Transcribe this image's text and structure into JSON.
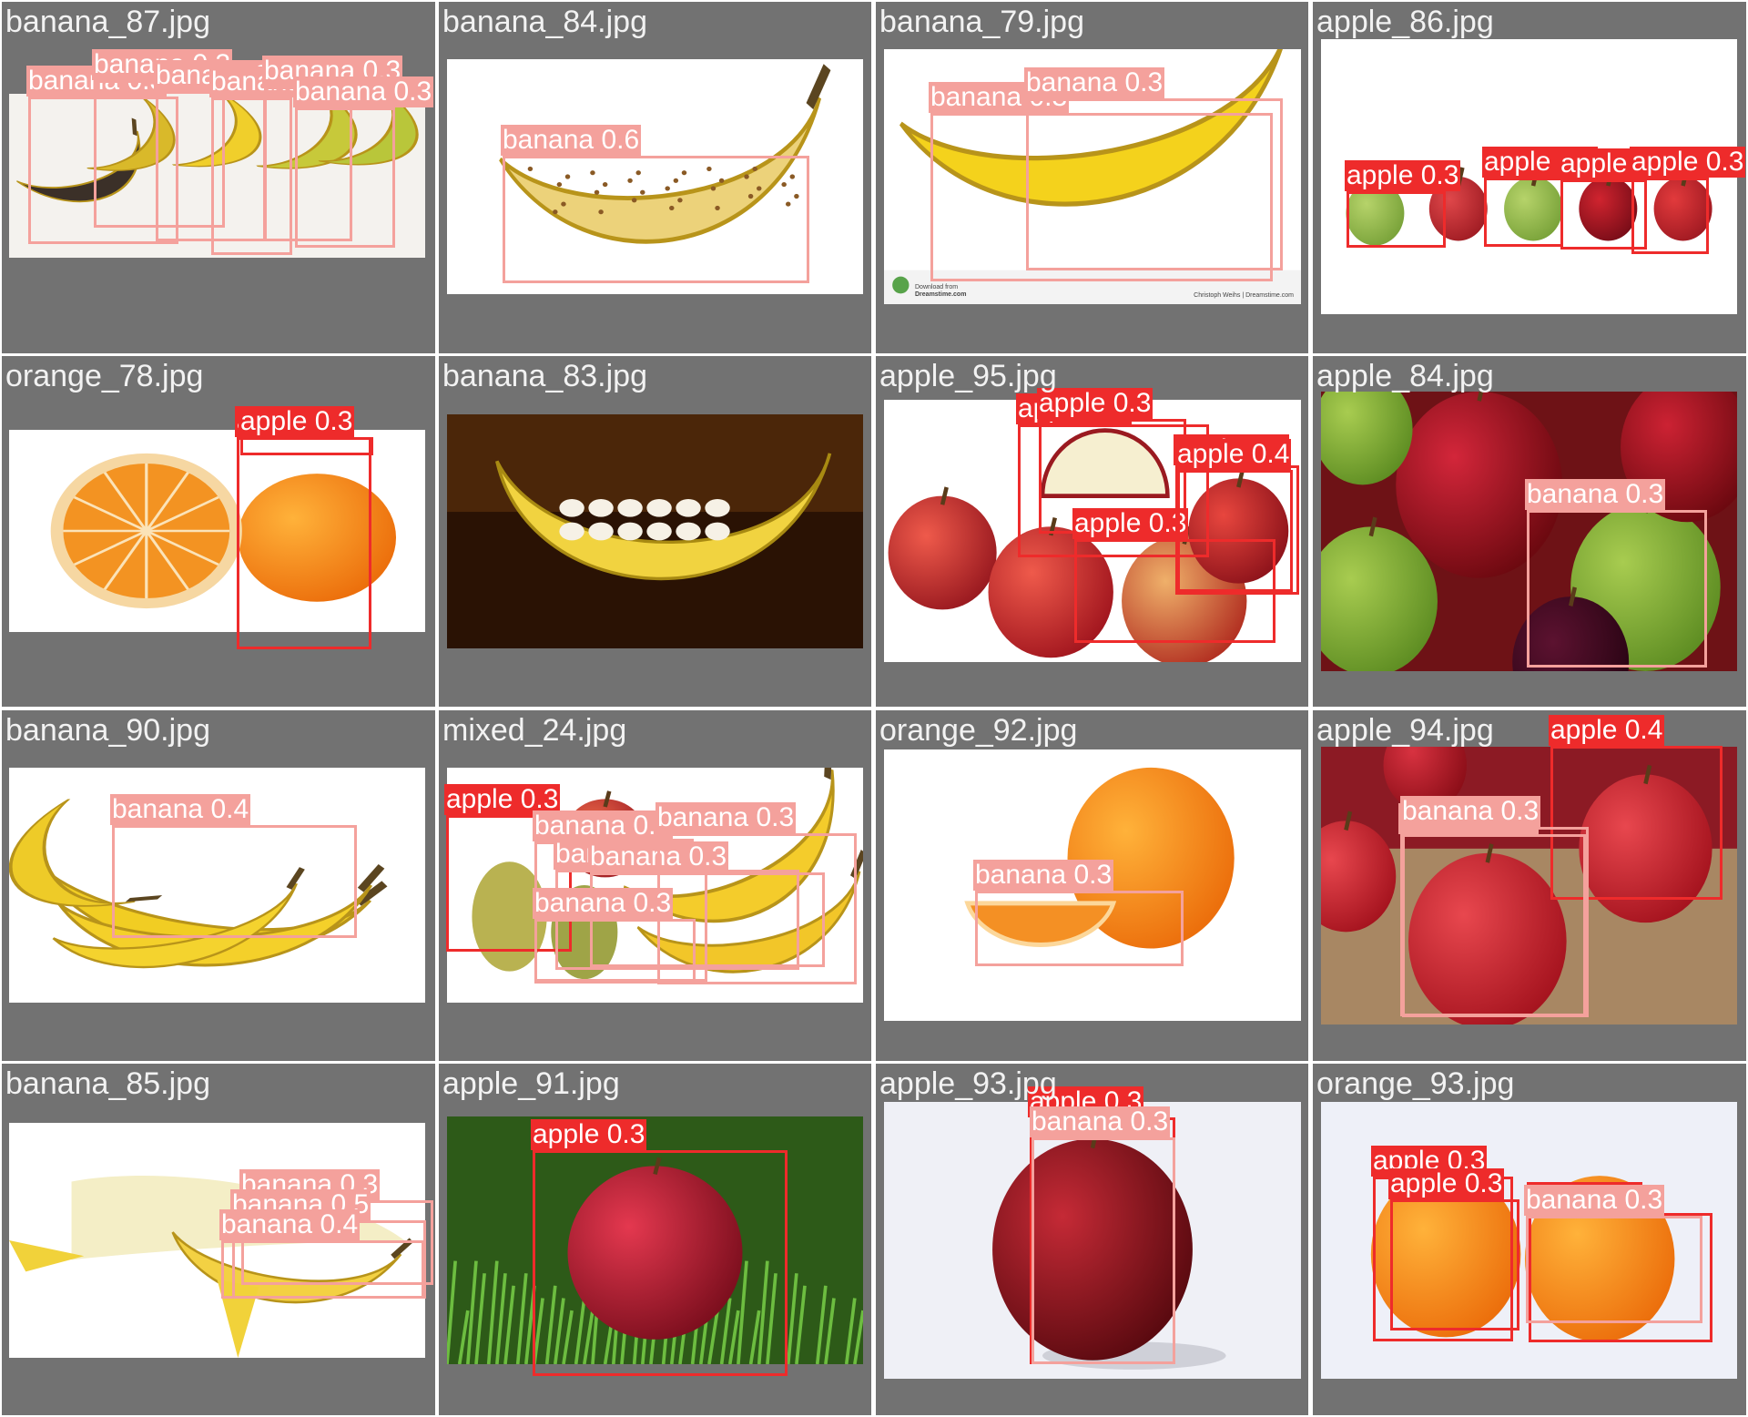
{
  "class_colors": {
    "apple": "#ee2b2b",
    "banana": "#f4a19c",
    "orange": "#ee2b2b"
  },
  "tiles": [
    {
      "filename": "banana_87.jpg",
      "scene": "bananas_row",
      "detections": [
        {
          "label": "banana 0.3",
          "cls": "banana"
        },
        {
          "label": "banana 0.3",
          "cls": "banana"
        },
        {
          "label": "banana 0.3",
          "cls": "banana"
        },
        {
          "label": "banana 0.3",
          "cls": "banana"
        },
        {
          "label": "banana 0.3",
          "cls": "banana"
        },
        {
          "label": "banana 0.3",
          "cls": "banana"
        }
      ]
    },
    {
      "filename": "banana_84.jpg",
      "scene": "single_banana_spotted",
      "detections": [
        {
          "label": "banana 0.6",
          "cls": "banana"
        }
      ]
    },
    {
      "filename": "banana_79.jpg",
      "scene": "single_banana_stock",
      "watermark": {
        "line1": "Download from",
        "line2": "Dreamstime.com",
        "right": "Christoph Weihs | Dreamstime.com"
      },
      "detections": [
        {
          "label": "banana 0.3",
          "cls": "banana"
        },
        {
          "label": "banana 0.3",
          "cls": "banana"
        }
      ]
    },
    {
      "filename": "apple_86.jpg",
      "scene": "five_apples_row",
      "detections": [
        {
          "label": "apple 0.3",
          "cls": "apple"
        },
        {
          "label": "apple 0.3",
          "cls": "apple"
        },
        {
          "label": "apple 0.3",
          "cls": "apple"
        },
        {
          "label": "apple 0.3",
          "cls": "apple"
        }
      ]
    },
    {
      "filename": "orange_78.jpg",
      "scene": "orange_half_and_whole",
      "detections": [
        {
          "label": "apple 0.3",
          "cls": "apple"
        },
        {
          "label": "apple 0.3",
          "cls": "apple"
        }
      ]
    },
    {
      "filename": "banana_83.jpg",
      "scene": "banana_boat_dark",
      "detections": []
    },
    {
      "filename": "apple_95.jpg",
      "scene": "apple_pile",
      "detections": [
        {
          "label": "apple 0.3",
          "cls": "apple"
        },
        {
          "label": "apple 0.3",
          "cls": "apple"
        },
        {
          "label": "apple 0.3",
          "cls": "apple"
        },
        {
          "label": "apple 0.3",
          "cls": "apple"
        },
        {
          "label": "apple 0.4",
          "cls": "apple"
        }
      ]
    },
    {
      "filename": "apple_84.jpg",
      "scene": "mixed_apples_closeup",
      "detections": [
        {
          "label": "banana 0.3",
          "cls": "banana"
        }
      ]
    },
    {
      "filename": "banana_90.jpg",
      "scene": "banana_bunch",
      "detections": [
        {
          "label": "banana 0.4",
          "cls": "banana"
        }
      ]
    },
    {
      "filename": "mixed_24.jpg",
      "scene": "pears_apple_bananas",
      "detections": [
        {
          "label": "apple 0.3",
          "cls": "apple"
        },
        {
          "label": "banana 0.3",
          "cls": "banana"
        },
        {
          "label": "banana 0.4",
          "cls": "banana"
        },
        {
          "label": "banana 0.3",
          "cls": "banana"
        },
        {
          "label": "banana 0.3",
          "cls": "banana"
        },
        {
          "label": "banana 0.3",
          "cls": "banana"
        }
      ]
    },
    {
      "filename": "orange_92.jpg",
      "scene": "orange_whole_and_slice",
      "detections": [
        {
          "label": "banana 0.3",
          "cls": "banana"
        }
      ]
    },
    {
      "filename": "apple_94.jpg",
      "scene": "red_apples_wood",
      "detections": [
        {
          "label": "apple 0.4",
          "cls": "apple"
        },
        {
          "label": "banana 0.3",
          "cls": "banana"
        },
        {
          "label": "banana 0.3",
          "cls": "banana"
        }
      ]
    },
    {
      "filename": "banana_85.jpg",
      "scene": "peeled_banana",
      "detections": [
        {
          "label": "banana 0.3",
          "cls": "banana"
        },
        {
          "label": "banana 0.5",
          "cls": "banana"
        },
        {
          "label": "banana 0.4",
          "cls": "banana"
        }
      ]
    },
    {
      "filename": "apple_91.jpg",
      "scene": "apple_on_grass",
      "detections": [
        {
          "label": "apple 0.3",
          "cls": "apple"
        }
      ]
    },
    {
      "filename": "apple_93.jpg",
      "scene": "single_red_apple",
      "detections": [
        {
          "label": "apple 0.3",
          "cls": "apple"
        },
        {
          "label": "banana 0.3",
          "cls": "banana"
        }
      ]
    },
    {
      "filename": "orange_93.jpg",
      "scene": "two_oranges",
      "detections": [
        {
          "label": "apple 0.3",
          "cls": "apple"
        },
        {
          "label": "apple 0.3",
          "cls": "apple"
        },
        {
          "label": "apple 0.3",
          "cls": "apple"
        },
        {
          "label": "banana 0.3",
          "cls": "banana"
        }
      ]
    }
  ]
}
